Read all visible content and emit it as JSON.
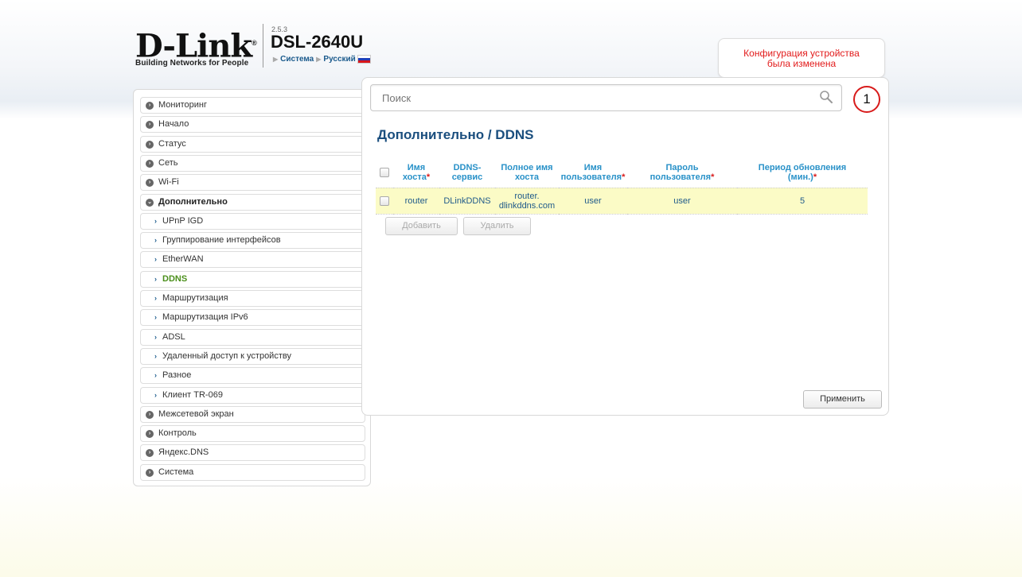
{
  "header": {
    "brand": "D-Link",
    "brand_mark": "®",
    "tagline": "Building Networks for People",
    "fw_version": "2.5.3",
    "model": "DSL-2640U",
    "menu_system": "Система",
    "menu_language": "Русский",
    "flag_colors": [
      "#ffffff",
      "#1f3fb8",
      "#d8151b"
    ]
  },
  "notification": {
    "text_line1": "Конфигурация устройства",
    "text_line2": "была изменена",
    "count": "1"
  },
  "search": {
    "placeholder": "Поиск"
  },
  "sidebar": {
    "items": [
      {
        "label": "Мониторинг"
      },
      {
        "label": "Начало"
      },
      {
        "label": "Статус"
      },
      {
        "label": "Сеть"
      },
      {
        "label": "Wi-Fi"
      },
      {
        "label": "Дополнительно"
      },
      {
        "label": "UPnP IGD"
      },
      {
        "label": "Группирование интерфейсов"
      },
      {
        "label": "EtherWAN"
      },
      {
        "label": "DDNS"
      },
      {
        "label": "Маршрутизация"
      },
      {
        "label": "Маршрутизация IPv6"
      },
      {
        "label": "ADSL"
      },
      {
        "label": "Удаленный доступ к устройству"
      },
      {
        "label": "Разное"
      },
      {
        "label": "Клиент TR-069"
      },
      {
        "label": "Межсетевой экран"
      },
      {
        "label": "Контроль"
      },
      {
        "label": "Яндекс.DNS"
      },
      {
        "label": "Система"
      }
    ]
  },
  "main": {
    "breadcrumb": "Дополнительно /  DDNS",
    "columns": {
      "hostname_1": "Имя",
      "hostname_2": "хоста",
      "service_1": "DDNS-",
      "service_2": "сервис",
      "fullhost_1": "Полное имя",
      "fullhost_2": "хоста",
      "user_1": "Имя",
      "user_2": "пользователя",
      "pass_1": "Пароль",
      "pass_2": "пользователя",
      "period_1": "Период обновления",
      "period_2": "(мин.)",
      "required_mark": "*"
    },
    "rows": [
      {
        "hostname": "router",
        "service": "DLinkDDNS",
        "fullhost_1": "router.",
        "fullhost_2": "dlinkddns.com",
        "username": "user",
        "password": "user",
        "period": "5"
      }
    ],
    "add_label": "Добавить",
    "delete_label": "Удалить",
    "apply_label": "Применить"
  },
  "colors": {
    "accent_title": "#1a4e7e",
    "header_link": "#2891c8",
    "active_menu": "#4b8f1b",
    "alert": "#e21b1b",
    "row_highlight": "#fbfbc6"
  }
}
